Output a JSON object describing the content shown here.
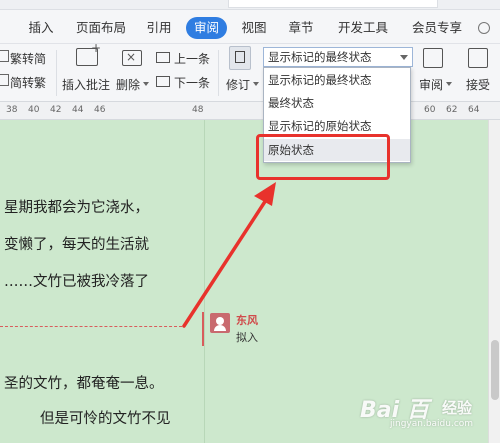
{
  "menu": {
    "tabs": [
      "插入",
      "页面布局",
      "引用",
      "审阅",
      "视图",
      "章节",
      "开发工具",
      "会员专享"
    ],
    "active_tab": "审阅"
  },
  "ribbon": {
    "trad_simp": "繁转简",
    "simp_trad": "简转繁",
    "insert_comment": "插入批注",
    "delete": "删除",
    "prev": "上一条",
    "next": "下一条",
    "track": "修订",
    "review": "审阅",
    "accept": "接受"
  },
  "display_select": {
    "current": "显示标记的最终状态",
    "options": [
      "显示标记的最终状态",
      "最终状态",
      "显示标记的原始状态",
      "原始状态"
    ],
    "highlighted": "原始状态"
  },
  "ruler": {
    "ticks": [
      "38",
      "40",
      "42",
      "44",
      "46",
      "48",
      "60",
      "62",
      "64"
    ]
  },
  "document": {
    "lines": [
      "星期我都会为它浇水，",
      "变懒了，每天的生活就",
      "……文竹已被我冷落了",
      "圣的文竹，都奄奄一息。",
      "但是可怜的文竹不见"
    ]
  },
  "comment": {
    "author": "东风",
    "text": "拟入"
  },
  "watermark": {
    "logo": "Bai 百",
    "sub": "经验",
    "url": "jingyan.baidu.com"
  },
  "colors": {
    "accent": "#2f7de1",
    "doc_bg": "#cde8cd",
    "annotation_red": "#e8322c"
  }
}
